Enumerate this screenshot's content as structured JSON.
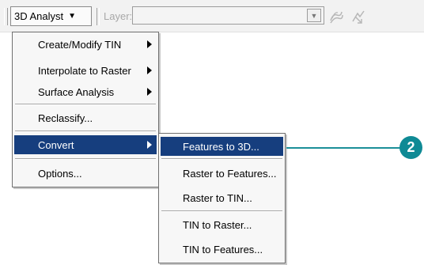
{
  "toolbar": {
    "menu_label": "3D Analyst",
    "layer_label": "Layer:",
    "layer_value": "",
    "icons": [
      "create-contours-icon",
      "steepest-path-icon"
    ]
  },
  "main_menu": {
    "items": [
      {
        "label": "Create/Modify TIN",
        "has_submenu": true
      },
      {
        "label": "Interpolate to Raster",
        "has_submenu": true
      },
      {
        "label": "Surface Analysis",
        "has_submenu": true
      },
      {
        "label": "Reclassify..."
      },
      {
        "label": "Convert",
        "has_submenu": true,
        "selected": true
      },
      {
        "label": "Options..."
      }
    ]
  },
  "convert_submenu": {
    "items": [
      {
        "label": "Features to 3D...",
        "selected": true
      },
      {
        "label": "Raster to Features..."
      },
      {
        "label": "Raster to TIN..."
      },
      {
        "label": "TIN to Raster..."
      },
      {
        "label": "TIN to Features..."
      }
    ]
  },
  "callout": {
    "number": "2",
    "color": "#0f8a95"
  },
  "colors": {
    "highlight": "#163e7e",
    "menu_bg": "#f7f7f7"
  }
}
